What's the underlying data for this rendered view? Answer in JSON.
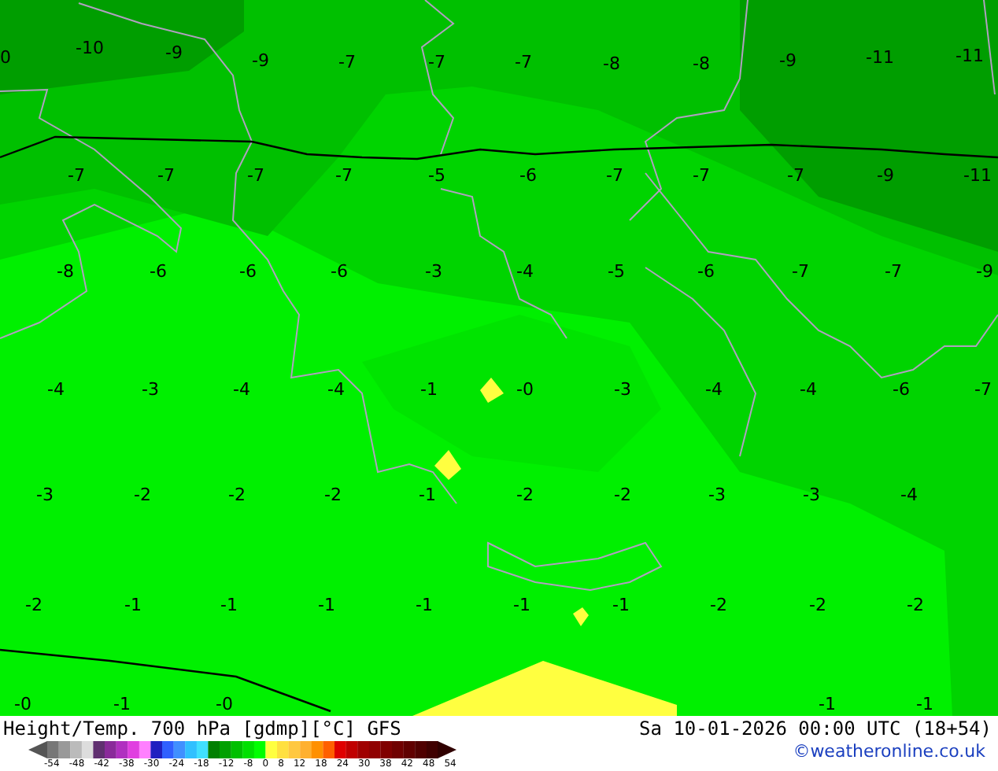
{
  "map": {
    "label_rows": [
      [
        "0",
        "-10",
        "-9",
        "-9",
        "-7",
        "-7",
        "-7",
        "-8",
        "-8",
        "-9",
        "-11",
        "-11"
      ],
      [
        "-7",
        "-7",
        "-7",
        "-7",
        "-5",
        "-6",
        "-7",
        "-7",
        "-7",
        "-9",
        "-11"
      ],
      [
        "-8",
        "-6",
        "-6",
        "-6",
        "-3",
        "-4",
        "-5",
        "-6",
        "-7",
        "-7",
        "-9"
      ],
      [
        "-4",
        "-3",
        "-4",
        "-4",
        "-1",
        "-0",
        "-3",
        "-4",
        "-4",
        "-6",
        "-7"
      ],
      [
        "-3",
        "-2",
        "-2",
        "-2",
        "-1",
        "-2",
        "-2",
        "-3",
        "-3",
        "-4"
      ],
      [
        "-2",
        "-1",
        "-1",
        "-1",
        "-1",
        "-1",
        "-1",
        "-2",
        "-2",
        "-2"
      ],
      [
        "-0",
        "-1",
        "-0",
        "-1",
        "-1"
      ]
    ]
  },
  "footer": {
    "title": "Height/Temp. 700 hPa [gdmp][°C] GFS",
    "datetime": "Sa 10-01-2026 00:00 UTC (18+54)",
    "copyright": "©weatheronline.co.uk",
    "legend_ticks": [
      "-54",
      "-48",
      "-42",
      "-38",
      "-30",
      "-24",
      "-18",
      "-12",
      "-8",
      "0",
      "8",
      "12",
      "18",
      "24",
      "30",
      "38",
      "42",
      "48",
      "54"
    ]
  }
}
